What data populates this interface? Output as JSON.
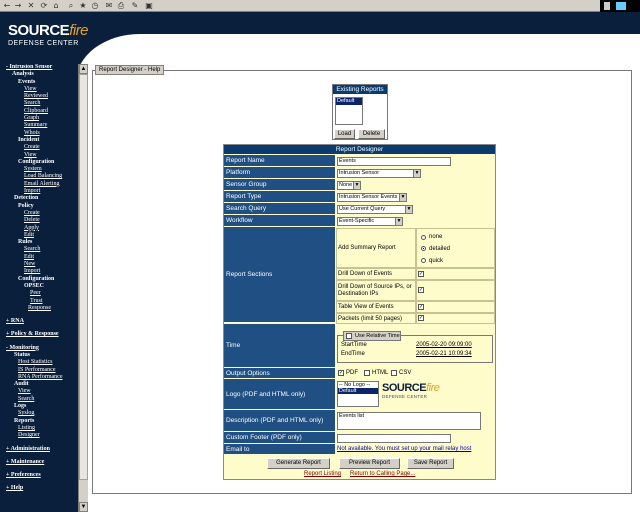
{
  "toolbar": {
    "icons": [
      "back-icon",
      "forward-icon",
      "stop-icon",
      "refresh-icon",
      "home-icon",
      "search-icon",
      "favorites-icon",
      "history-icon",
      "mail-icon",
      "print-icon",
      "edit-icon",
      "discuss-icon"
    ]
  },
  "header": {
    "logo_main": "SOURCE",
    "logo_accent": "fire",
    "tagline": "DEFENSE CENTER",
    "colors": {
      "navy": "#0a1f3c",
      "accent": "#e7a21e"
    }
  },
  "sidebar": [
    {
      "label": "- Intrusion Sensor",
      "kind": "sec",
      "indent": 6
    },
    {
      "label": "Analysis",
      "kind": "b",
      "indent": 12
    },
    {
      "label": "Events",
      "kind": "b",
      "indent": 18
    },
    {
      "label": "View",
      "kind": "l",
      "indent": 24
    },
    {
      "label": "Reviewed",
      "kind": "l",
      "indent": 24
    },
    {
      "label": "Search",
      "kind": "l",
      "indent": 24
    },
    {
      "label": "Clipboard",
      "kind": "l",
      "indent": 24
    },
    {
      "label": "Graph",
      "kind": "l",
      "indent": 24
    },
    {
      "label": "Summary",
      "kind": "l",
      "indent": 24
    },
    {
      "label": "Whois",
      "kind": "l",
      "indent": 24
    },
    {
      "label": "Incident",
      "kind": "b",
      "indent": 18
    },
    {
      "label": "Create",
      "kind": "l",
      "indent": 24
    },
    {
      "label": "View",
      "kind": "l",
      "indent": 24
    },
    {
      "label": "Configuration",
      "kind": "b",
      "indent": 18
    },
    {
      "label": "System",
      "kind": "l",
      "indent": 24
    },
    {
      "label": "Load Balancing",
      "kind": "l",
      "indent": 24
    },
    {
      "label": "Email Alerting",
      "kind": "l",
      "indent": 24
    },
    {
      "label": "Import",
      "kind": "l",
      "indent": 24
    },
    {
      "label": "Detection",
      "kind": "b",
      "indent": 14
    },
    {
      "label": "Policy",
      "kind": "b",
      "indent": 18
    },
    {
      "label": "Create",
      "kind": "l",
      "indent": 24
    },
    {
      "label": "Delete",
      "kind": "l",
      "indent": 24
    },
    {
      "label": "Apply",
      "kind": "l",
      "indent": 24
    },
    {
      "label": "Edit",
      "kind": "l",
      "indent": 24
    },
    {
      "label": "Rules",
      "kind": "b",
      "indent": 18
    },
    {
      "label": "Search",
      "kind": "l",
      "indent": 24
    },
    {
      "label": "Edit",
      "kind": "l",
      "indent": 24
    },
    {
      "label": "New",
      "kind": "l",
      "indent": 24
    },
    {
      "label": "Import",
      "kind": "l",
      "indent": 24
    },
    {
      "label": "Configuration",
      "kind": "b",
      "indent": 18
    },
    {
      "label": "OPSEC",
      "kind": "b",
      "indent": 24
    },
    {
      "label": "Peer",
      "kind": "l",
      "indent": 30
    },
    {
      "label": "Trust",
      "kind": "l",
      "indent": 30
    },
    {
      "label": "Response",
      "kind": "l",
      "indent": 28
    },
    {
      "label": "+ RNA",
      "kind": "sec",
      "indent": 6
    },
    {
      "label": "+ Policy & Response",
      "kind": "sec",
      "indent": 6
    },
    {
      "label": "- Monitoring",
      "kind": "sec",
      "indent": 6
    },
    {
      "label": "Status",
      "kind": "b",
      "indent": 14
    },
    {
      "label": "Host Statistics",
      "kind": "l",
      "indent": 18
    },
    {
      "label": "IS Performance",
      "kind": "l",
      "indent": 18
    },
    {
      "label": "RNA Performance",
      "kind": "l",
      "indent": 18
    },
    {
      "label": "Audit",
      "kind": "b",
      "indent": 14
    },
    {
      "label": "View",
      "kind": "l",
      "indent": 18
    },
    {
      "label": "Search",
      "kind": "l",
      "indent": 18
    },
    {
      "label": "Logs",
      "kind": "b",
      "indent": 14
    },
    {
      "label": "Syslog",
      "kind": "l",
      "indent": 18
    },
    {
      "label": "Reports",
      "kind": "b",
      "indent": 14
    },
    {
      "label": "Listing",
      "kind": "l",
      "indent": 18
    },
    {
      "label": "Designer",
      "kind": "l",
      "indent": 18
    },
    {
      "label": "+ Administration",
      "kind": "sec",
      "indent": 6
    },
    {
      "label": "+ Maintenance",
      "kind": "sec",
      "indent": 6
    },
    {
      "label": "+ Preferences",
      "kind": "sec",
      "indent": 6
    },
    {
      "label": "+ Help",
      "kind": "sec",
      "indent": 6
    }
  ],
  "panel_tab": "Report Designer - Help",
  "existing": {
    "title": "Existing Reports",
    "items": [
      "Default"
    ],
    "load": "Load",
    "delete": "Delete"
  },
  "designer": {
    "title": "Report Designer",
    "report_name": {
      "label": "Report Name",
      "value": "Events"
    },
    "platform": {
      "label": "Platform",
      "value": "Intrusion Sensor"
    },
    "sensor_group": {
      "label": "Sensor Group",
      "value": "None"
    },
    "report_type": {
      "label": "Report Type",
      "value": "Intrusion Sensor Events"
    },
    "search_query": {
      "label": "Search Query",
      "value": "Use Current Query"
    },
    "workflow": {
      "label": "Workflow",
      "value": "Event-Specific"
    },
    "sections": {
      "label": "Report Sections",
      "add_summary": "Add Summary Report",
      "summary_opts": [
        "none",
        "detailed",
        "quick"
      ],
      "summary_selected": "detailed",
      "drill_events": "Drill Down of Events",
      "drill_source": "Drill Down of Source IPs, or Destination IPs",
      "table_view": "Table View of Events",
      "packets": "Packets (limit 50 pages)"
    },
    "time": {
      "label": "Time",
      "relative": "Use Relative Time",
      "start_label": "StartTime",
      "start_value": "2005-02-20 09:09:00",
      "end_label": "EndTime",
      "end_value": "2005-02-21 10:09:34"
    },
    "output": {
      "label": "Output Options",
      "pdf": "PDF",
      "html": "HTML",
      "csv": "CSV"
    },
    "logo": {
      "label": "Logo (PDF and HTML only)",
      "items": [
        "-- No Logo --",
        "Default"
      ],
      "preview_main": "SOURCE",
      "preview_accent": "fire",
      "preview_sub": "DEFENSE CENTER"
    },
    "description": {
      "label": "Description (PDF and HTML only)",
      "value": "Events list"
    },
    "footer": {
      "label": "Custom Footer (PDF only)",
      "value": ""
    },
    "email": {
      "label": "Email to",
      "value": "Not available. You must set up your mail relay host"
    },
    "buttons": {
      "generate": "Generate Report",
      "preview": "Preview Report",
      "save": "Save Report"
    },
    "links": {
      "listing": "Report Listing",
      "return": "Return to Calling Page..."
    }
  }
}
